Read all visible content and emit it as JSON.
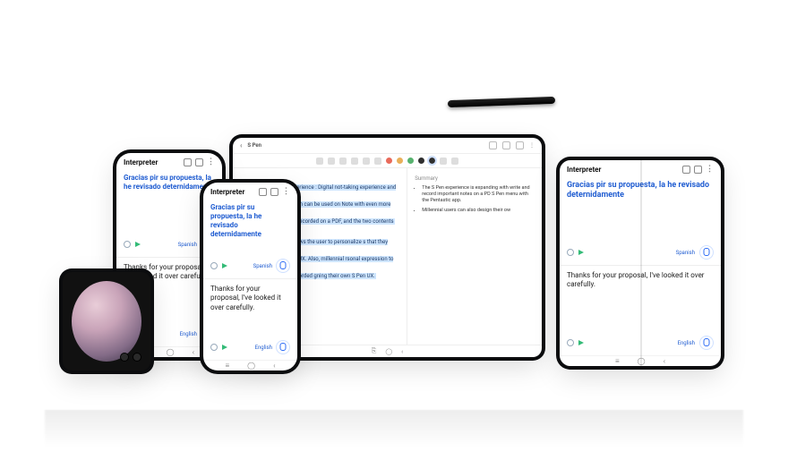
{
  "interpreter": {
    "title": "Interpreter",
    "source_text": "Gracias pir su propuesta, la he revisado deternidamente",
    "target_text": "Thanks for your proposal, I've looked it over carefully.",
    "source_lang": "Spanish",
    "target_lang": "English"
  },
  "tablet": {
    "doc_title": "S Pen",
    "note_p1": "Exanding the S Pen experience : Digital not-taking experience and customizing UX The S Pen can be used on Note with even more freedom. _e written and recorded on a PDF, and the two contents",
    "note_p2": "app called Pentastic allows the user to personalize s that they want and customize the UX. Also, millennial rsonal expression to be very important are afforded gning their own S Pen UX.",
    "summary_heading": "Summary",
    "summary_1": "The S Pen experience is expanding with write and record important notes on a PD S Pen menu with the Pentastic app.",
    "summary_2": "Millennial users can also design their ow",
    "swatches": [
      "#e96a5a",
      "#e9b05a",
      "#57b26e",
      "#2f2f2f",
      "#2f2f2f"
    ]
  }
}
